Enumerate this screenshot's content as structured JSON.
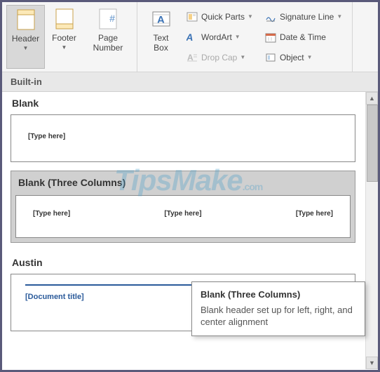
{
  "ribbon": {
    "header": "Header",
    "footer": "Footer",
    "page_number": "Page\nNumber",
    "text_box": "Text\nBox",
    "quick_parts": "Quick Parts",
    "wordart": "WordArt",
    "drop_cap": "Drop Cap",
    "signature": "Signature Line",
    "datetime": "Date & Time",
    "object": "Object"
  },
  "gallery": {
    "heading": "Built-in",
    "sections": {
      "blank": "Blank",
      "blank_three": "Blank (Three Columns)",
      "austin": "Austin"
    },
    "placeholders": {
      "type_here": "[Type here]",
      "doc_title": "[Document title]"
    }
  },
  "tooltip": {
    "title": "Blank (Three Columns)",
    "desc": "Blank header set up for left, right, and center alignment"
  },
  "watermark": {
    "main": "TipsMake",
    "suffix": ".com"
  }
}
